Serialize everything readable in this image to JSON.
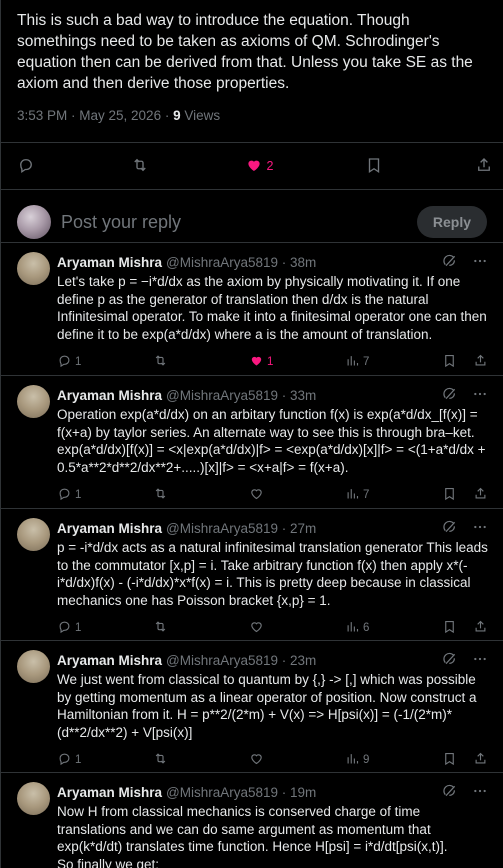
{
  "main": {
    "text": "This is such a bad way to introduce the equation. Though somethings need to be taken as axioms of QM. Schrodinger's equation then can be derived from that. Unless you take SE as the axiom and then derive those properties.",
    "time": "3:53 PM · May 25, 2026 · ",
    "views_count": "9",
    "views_label": " Views",
    "reply_count": "",
    "retweet_count": "",
    "like_count": "2"
  },
  "reply_box": {
    "placeholder": "Post your reply",
    "button": "Reply"
  },
  "replies": [
    {
      "name": "Aryaman Mishra",
      "handle": "@MishraArya5819 · 38m",
      "text": "Let's take p = −i*d/dx as the axiom by physically motivating it. If one define p as the generator of translation then d/dx is the natural Infinitesimal operator. To make it into a finitesimal operator one can then define it to be exp(a*d/dx) where a is the amount of translation.",
      "replies": "1",
      "retweets": "",
      "likes": "1",
      "views": "7",
      "liked": true
    },
    {
      "name": "Aryaman Mishra",
      "handle": "@MishraArya5819 · 33m",
      "text": "Operation exp(a*d/dx) on an arbitary function f(x) is exp(a*d/dx_[f(x)] = f(x+a) by taylor series. An alternate way to see this is through bra–ket. exp(a*d/dx)[f(x)] = <x|exp(a*d/dx)|f> = <exp(a*d/dx)[x]|f> = <(1+a*d/dx + 0.5*a**2*d**2/dx**2+.....)[x]|f> = <x+a|f> = f(x+a).",
      "replies": "1",
      "retweets": "",
      "likes": "",
      "views": "7",
      "liked": false
    },
    {
      "name": "Aryaman Mishra",
      "handle": "@MishraArya5819 · 27m",
      "text": "p = -i*d/dx acts as a natural infinitesimal translation generator This leads to the commutator [x,p] = i. Take arbitrary function f(x) then apply x*(-i*d/dx)f(x) - (-i*d/dx)*x*f(x) = i. This is pretty deep because in classical mechanics one has Poisson bracket {x,p} = 1.",
      "replies": "1",
      "retweets": "",
      "likes": "",
      "views": "6",
      "liked": false
    },
    {
      "name": "Aryaman Mishra",
      "handle": "@MishraArya5819 · 23m",
      "text": "We just went from classical to quantum by {,} -> [,] which was possible by getting momentum as a linear operator of position. Now construct a Hamiltonian from it. H = p**2/(2*m) + V(x) => H[psi(x)] = (-1/(2*m)*(d**2/dx**2) + V[psi(x)]",
      "replies": "1",
      "retweets": "",
      "likes": "",
      "views": "9",
      "liked": false
    },
    {
      "name": "Aryaman Mishra",
      "handle": "@MishraArya5819 · 19m",
      "text": "Now H from classical mechanics is conserved charge of time translations and we can do same argument as momentum that exp(k*d/dt) translates time function. Hence H[psi] = i*d/dt[psi(x,t)].\nSo finally we get:",
      "replies": "",
      "retweets": "",
      "likes": "",
      "views": "",
      "liked": false
    }
  ],
  "colors": {
    "accent_like": "#f91880",
    "muted": "#71767b",
    "text": "#e7e9ea",
    "bg": "#000000"
  }
}
